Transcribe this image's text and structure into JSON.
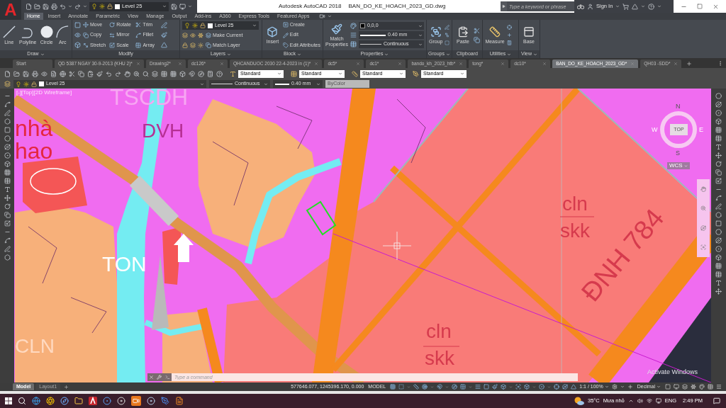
{
  "title_bar": {
    "logo": "A",
    "layer": "Level 25",
    "app": "Autodesk AutoCAD 2018",
    "file": "BAN_DO_KE_HOACH_2023_GD.dwg",
    "search": {
      "placeholder": "Type a keyword or phrase"
    },
    "sign_in": "Sign In"
  },
  "ribbon_tabs": [
    {
      "label": "Home",
      "selected": true
    },
    {
      "label": "Insert",
      "selected": false
    },
    {
      "label": "Annotate",
      "selected": false
    },
    {
      "label": "Parametric",
      "selected": false
    },
    {
      "label": "View",
      "selected": false
    },
    {
      "label": "Manage",
      "selected": false
    },
    {
      "label": "Output",
      "selected": false
    },
    {
      "label": "Add-ins",
      "selected": false
    },
    {
      "label": "A360",
      "selected": false
    },
    {
      "label": "Express Tools",
      "selected": false
    },
    {
      "label": "Featured Apps",
      "selected": false
    }
  ],
  "ribbon": {
    "draw": {
      "title": "Draw",
      "menu": true,
      "tools": [
        "Line",
        "Polyline",
        "Circle",
        "Arc"
      ]
    },
    "modify": {
      "title": "Modify",
      "menu": false,
      "tools": [
        "Move",
        "Rotate",
        "Trim",
        "Copy",
        "Mirror",
        "Fillet",
        "Stretch",
        "Scale",
        "Array"
      ]
    },
    "layers": {
      "title": "Layers",
      "menu": true,
      "layer": "Level 25",
      "tools": [
        "Make Current",
        "Match Layer"
      ]
    },
    "block": {
      "title": "Block",
      "menu": true,
      "insert": "Insert",
      "tools": [
        "Create",
        "Edit",
        "Edit Attributes"
      ]
    },
    "properties": {
      "title": "Properties",
      "menu": true,
      "match": "Match Properties",
      "rgb": "0,0,0",
      "lineweight": "0.40 mm",
      "linetype": "Continuous"
    },
    "groups": {
      "title": "Groups",
      "menu": true,
      "tool": "Group"
    },
    "clipboard": {
      "title": "Clipboard",
      "menu": false,
      "tool": "Paste"
    },
    "utilities": {
      "title": "Utilities",
      "menu": true,
      "tool": "Measure"
    },
    "view": {
      "title": "View",
      "menu": true,
      "tool": "Base"
    }
  },
  "file_tabs": [
    {
      "label": "Start",
      "kind": "start",
      "selected": false
    },
    {
      "label": "QD 5387 NGAY 30-9-2013 (KHU 2)*",
      "kind": "drawing",
      "selected": false
    },
    {
      "label": "Drawing2*",
      "kind": "drawing",
      "selected": false
    },
    {
      "label": "dc126*",
      "kind": "drawing",
      "selected": false
    },
    {
      "label": "QHCANDUOC 2030 22-4-2023 in (1)*",
      "kind": "drawing",
      "selected": false
    },
    {
      "label": "dc5*",
      "kind": "drawing",
      "selected": false
    },
    {
      "label": "dc1*",
      "kind": "drawing",
      "selected": false
    },
    {
      "label": "bando_kh_2023_htb*",
      "kind": "drawing",
      "selected": false
    },
    {
      "label": "tong*",
      "kind": "drawing",
      "selected": false
    },
    {
      "label": "dc10*",
      "kind": "drawing",
      "selected": false
    },
    {
      "label": "BAN_DO_KE_HOACH_2023_GD*",
      "kind": "drawing",
      "selected": true
    },
    {
      "label": "QH03 -SDD*",
      "kind": "drawing",
      "selected": false
    }
  ],
  "toolbar": {
    "styles": [
      "Standard",
      "Standard",
      "Standard",
      "Standard"
    ]
  },
  "properties_bar": {
    "layer": "Level 25",
    "linetype": "Continuous",
    "lineweight": "0.40 mm",
    "plot_style": {
      "value": "ByColor",
      "disabled": true
    }
  },
  "viewport": {
    "controls": "[-][Top][2D Wireframe]",
    "labels": [
      "TSCDH",
      "DVH",
      "nhà",
      "hao",
      "TON",
      "CLN",
      "cln",
      "skk",
      "cln",
      "skk",
      "ĐNH 784"
    ],
    "viewcube": {
      "north": "N",
      "west": "W",
      "east": "E",
      "south": "S",
      "face": "TOP",
      "ucs": "WCS"
    },
    "notice": "Activate Windows"
  },
  "command_line": {
    "placeholder": "Type a command"
  },
  "layout_tabs": [
    {
      "label": "Model",
      "selected": true
    },
    {
      "label": "Layout1",
      "selected": false
    }
  ],
  "status_bar": {
    "coordinates": "577646.077, 1245396.170, 0.000",
    "space": "MODEL",
    "scale": "1:1 / 100%",
    "units": "Decimal"
  },
  "taskbar": {
    "temperature": "35°C",
    "weather": "Mưa nhỏ",
    "language": "ENG",
    "time": "2:49 PM"
  }
}
